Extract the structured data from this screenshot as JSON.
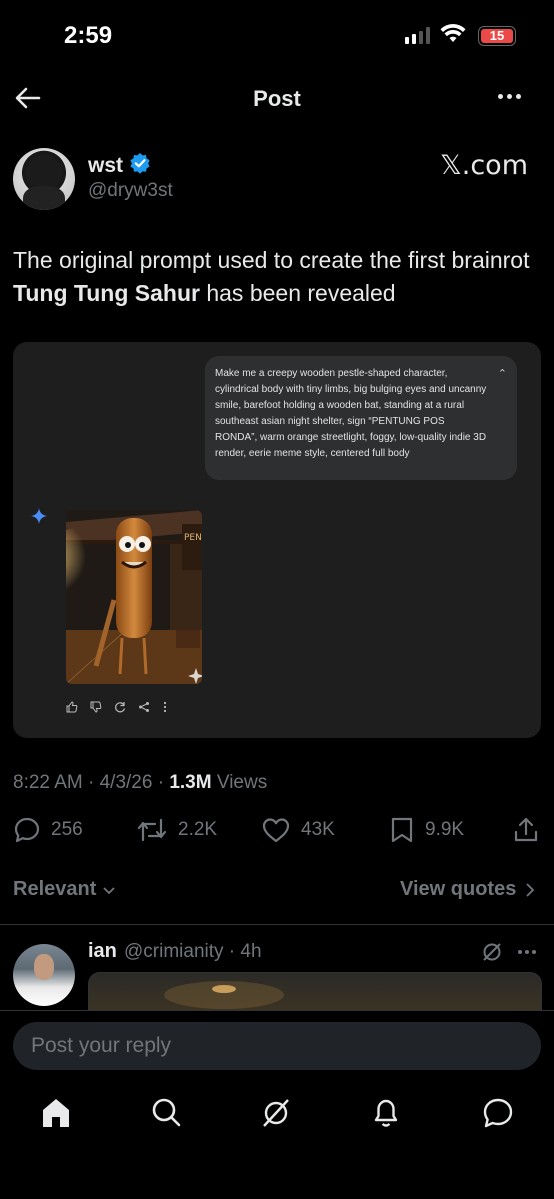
{
  "status_bar": {
    "time": "2:59",
    "battery": "15"
  },
  "header": {
    "title": "Post"
  },
  "author": {
    "name": "wst",
    "handle": "@dryw3st",
    "brand": "𝕏.com"
  },
  "tweet": {
    "text_before": "The original prompt used to create the first brainrot ",
    "text_bold": "Tung Tung Sahur",
    "text_after": " has been revealed"
  },
  "embed": {
    "prompt": "Make me a creepy wooden pestle-shaped character, cylindrical body with tiny limbs, big bulging eyes and uncanny smile, barefoot holding a wooden bat, standing at a rural southeast asian night shelter, sign “PENTUNG POS RONDA”, warm orange streetlight, foggy, low-quality indie 3D render, eerie meme style, centered full body",
    "sign_text": "PEN POS"
  },
  "meta": {
    "time": "8:22 AM",
    "date": "4/3/26",
    "views_count": "1.3M",
    "views_label": "Views"
  },
  "actions": {
    "replies": "256",
    "reposts": "2.2K",
    "likes": "43K",
    "bookmarks": "9.9K"
  },
  "sort": {
    "relevant": "Relevant",
    "view_quotes": "View quotes"
  },
  "reply": {
    "name": "ian",
    "handle_time": "@crimianity · 4h"
  },
  "composer": {
    "placeholder": "Post your reply"
  },
  "colors": {
    "accent": "#1d9bf0",
    "verified": "#1d9bf0",
    "battery_low": "#eb4848"
  }
}
